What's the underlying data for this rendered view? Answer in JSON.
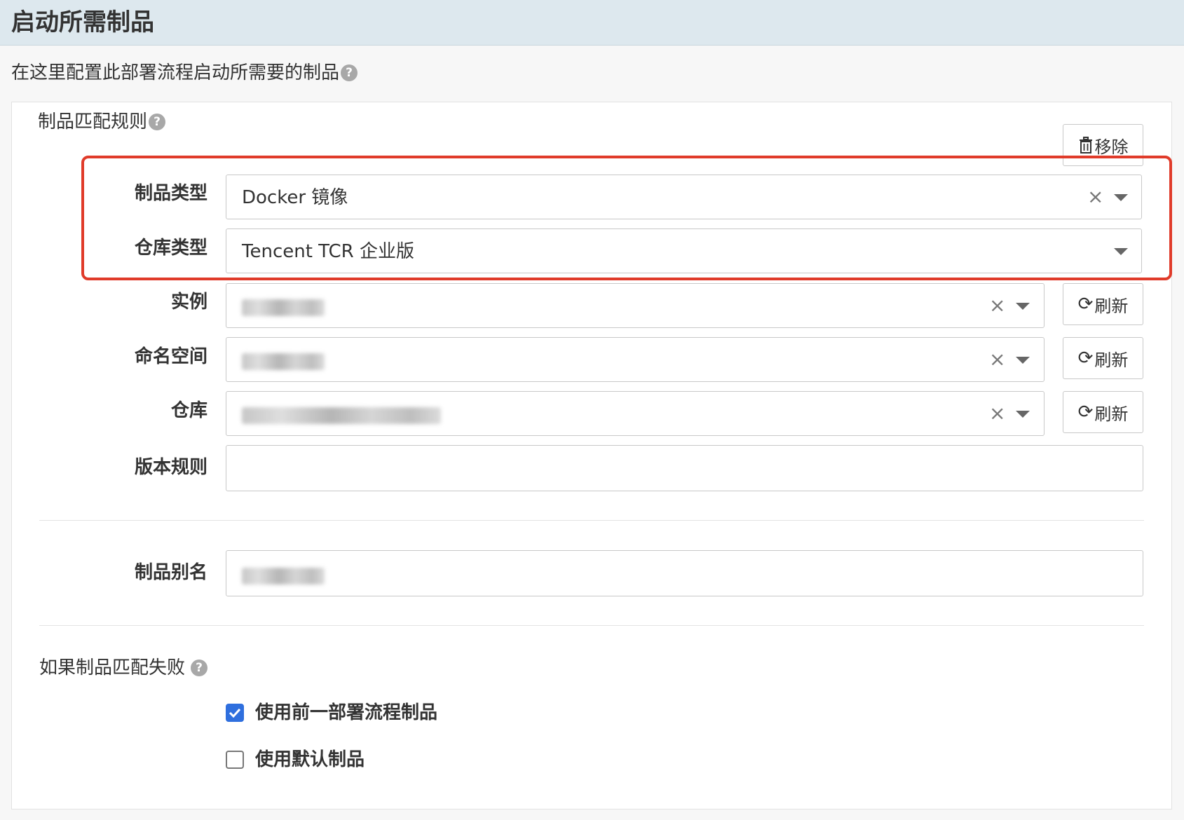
{
  "header": {
    "title": "启动所需制品"
  },
  "description": {
    "text": "在这里配置此部署流程启动所需要的制品"
  },
  "rules": {
    "label": "制品匹配规则",
    "remove_button": "移除",
    "artifact_type": {
      "label": "制品类型",
      "value": "Docker 镜像"
    },
    "registry_type": {
      "label": "仓库类型",
      "value": "Tencent TCR 企业版"
    },
    "instance": {
      "label": "实例",
      "value_obscured": true
    },
    "namespace": {
      "label": "命名空间",
      "value_obscured": true
    },
    "repository": {
      "label": "仓库",
      "value_obscured": true
    },
    "version_rule": {
      "label": "版本规则",
      "value": ""
    },
    "refresh_label": "刷新"
  },
  "alias": {
    "label": "制品别名",
    "value_obscured": true
  },
  "fallback": {
    "label": "如果制品匹配失败",
    "options": [
      {
        "label": "使用前一部署流程制品",
        "checked": true
      },
      {
        "label": "使用默认制品",
        "checked": false
      }
    ]
  },
  "colors": {
    "highlight": "#e03b2a",
    "checkbox_checked": "#2f6fde",
    "header_bg": "#dde8ee"
  }
}
